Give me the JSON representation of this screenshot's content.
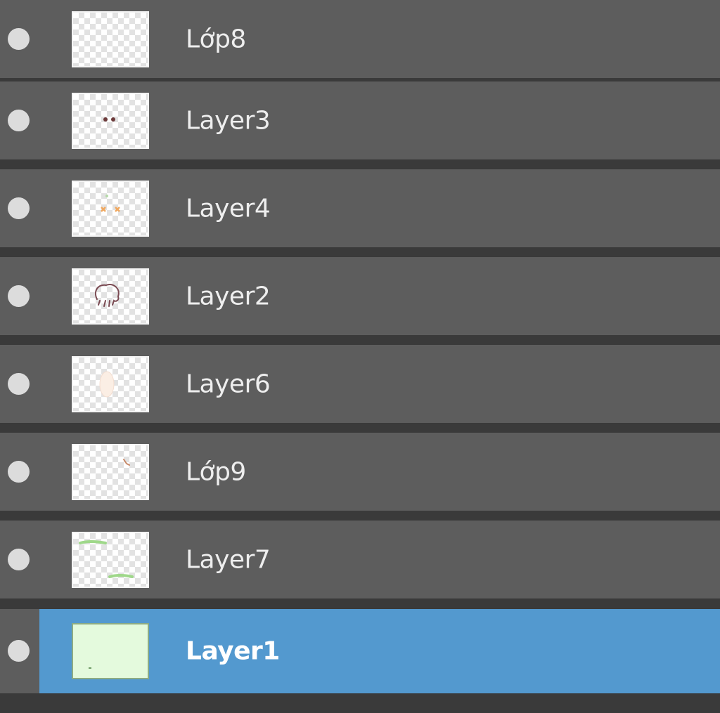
{
  "layers_panel": {
    "layers": [
      {
        "name": "Lớp8",
        "visible": true,
        "selected": false,
        "thumbnail": "transparent-empty"
      },
      {
        "name": "Layer3",
        "visible": true,
        "selected": false,
        "thumbnail": "eyes-sketch"
      },
      {
        "name": "Layer4",
        "visible": true,
        "selected": false,
        "thumbnail": "orange-marks"
      },
      {
        "name": "Layer2",
        "visible": true,
        "selected": false,
        "thumbnail": "head-outline"
      },
      {
        "name": "Layer6",
        "visible": true,
        "selected": false,
        "thumbnail": "faint-shape"
      },
      {
        "name": "Lớp9",
        "visible": true,
        "selected": false,
        "thumbnail": "small-stroke"
      },
      {
        "name": "Layer7",
        "visible": true,
        "selected": false,
        "thumbnail": "green-grass"
      },
      {
        "name": "Layer1",
        "visible": true,
        "selected": true,
        "thumbnail": "light-green-fill"
      }
    ]
  },
  "colors": {
    "panel_background": "#5d5d5d",
    "row_separator": "#1e1e1e",
    "selected_row": "#5399cf",
    "visibility_dot": "#dcdcdc",
    "label_text": "#eeeeee"
  }
}
